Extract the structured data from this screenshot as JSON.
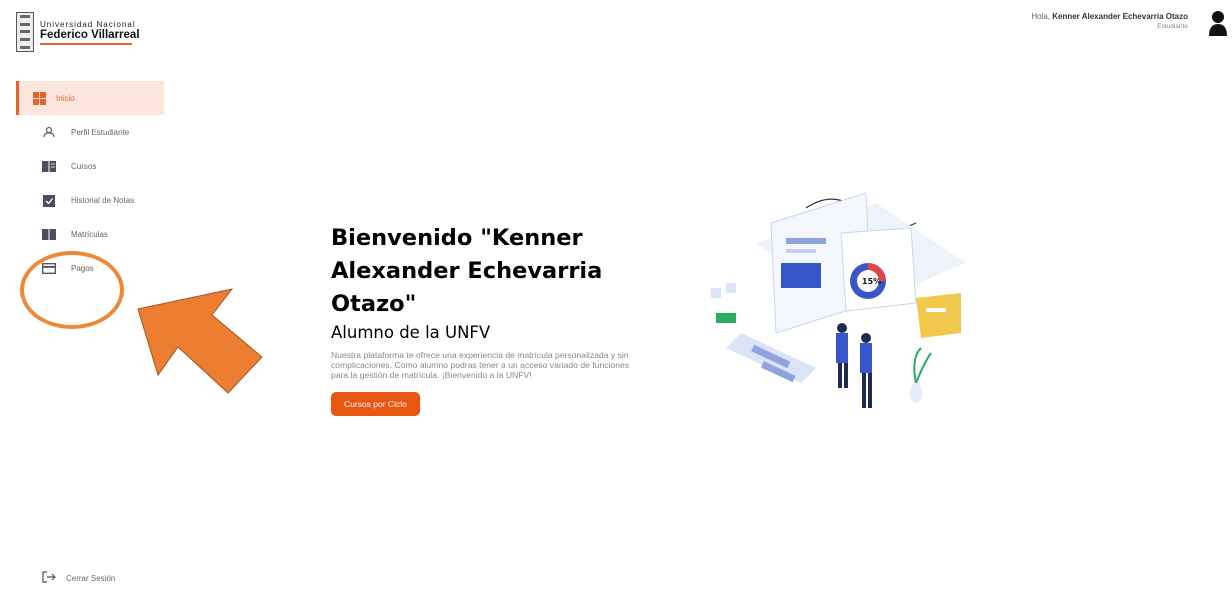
{
  "logo": {
    "line1": "Universidad Nacional",
    "line2": "Federico Villarreal"
  },
  "header": {
    "greeting": "Hola,",
    "user_name": "Kenner Alexander Echevarria Otazo",
    "role": "Estudiante",
    "avatar_icon": "user-icon"
  },
  "sidebar": {
    "items": [
      {
        "label": "Inicio",
        "icon": "grid-icon",
        "active": true
      },
      {
        "label": "Perfil Estudiante",
        "icon": "user-icon"
      },
      {
        "label": "Cursos",
        "icon": "book-icon"
      },
      {
        "label": "Historial de Notas",
        "icon": "clipboard-check-icon"
      },
      {
        "label": "Matrículas",
        "icon": "book-icon"
      },
      {
        "label": "Pagos",
        "icon": "credit-card-icon"
      }
    ],
    "logout": {
      "label": "Cerrar Sesión",
      "icon": "logout-icon"
    }
  },
  "main": {
    "title": "Bienvenido \"Kenner Alexander Echevarria Otazo\"",
    "subtitle": "Alumno de la UNFV",
    "description": "Nuestra plataforma te ofrece una experiencia de matrícula personalizada y sin complicaciones. Como alumno podras tener a un acceso variado de funciones para la gestión de matrícula. ¡Bienvenido a la UNFV!",
    "cta_label": "Cursos por Ciclo",
    "illustration_value": "15%"
  },
  "colors": {
    "accent": "#e8622a",
    "active_bg": "#fce5db",
    "button": "#e8560f",
    "annotation": "#ec8a3a"
  }
}
